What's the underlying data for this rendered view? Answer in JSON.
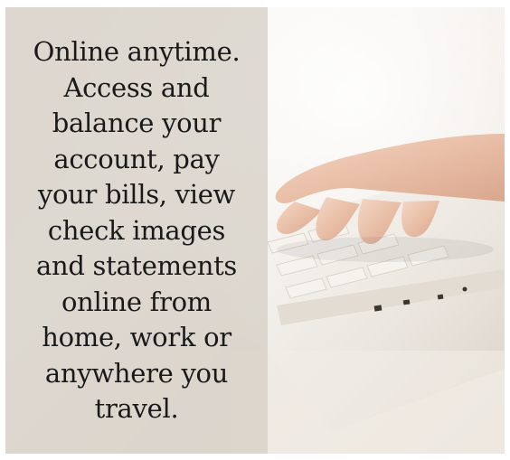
{
  "promo": {
    "lines": [
      "Online anytime.",
      "Access and",
      "balance your",
      "account, pay",
      "your bills, view",
      "check images",
      "and statements",
      "online from",
      "home, work or",
      "anywhere you",
      "travel."
    ]
  },
  "photo": {
    "subject": "hands-typing-on-laptop-keyboard",
    "panel_color": "#d6cfc7",
    "text_color": "#1a1a1a"
  }
}
